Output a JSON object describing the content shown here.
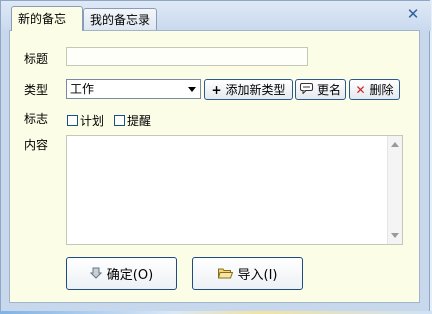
{
  "tabs": [
    {
      "label": "新的备忘",
      "active": true
    },
    {
      "label": "我的备忘录",
      "active": false
    }
  ],
  "close_icon": "close-icon",
  "form": {
    "title_label": "标题",
    "title_value": "",
    "type_label": "类型",
    "type_selected": "工作",
    "add_type_label": "添加新类型",
    "rename_label": "更名",
    "delete_label": "删除",
    "flag_label": "标志",
    "flags": [
      {
        "label": "计划",
        "checked": false
      },
      {
        "label": "提醒",
        "checked": false
      }
    ],
    "content_label": "内容",
    "content_value": ""
  },
  "buttons": {
    "confirm_label": "确定(O)",
    "import_label": "导入(I)"
  },
  "icons": {
    "add": "plus-icon",
    "rename": "speech-bubble-icon",
    "delete": "red-x-icon",
    "confirm": "down-arrow-icon",
    "import": "folder-icon"
  },
  "colors": {
    "panel_bg": "#fcfde6",
    "accent_border": "#2c5a8e",
    "delete_icon": "#d12020"
  }
}
